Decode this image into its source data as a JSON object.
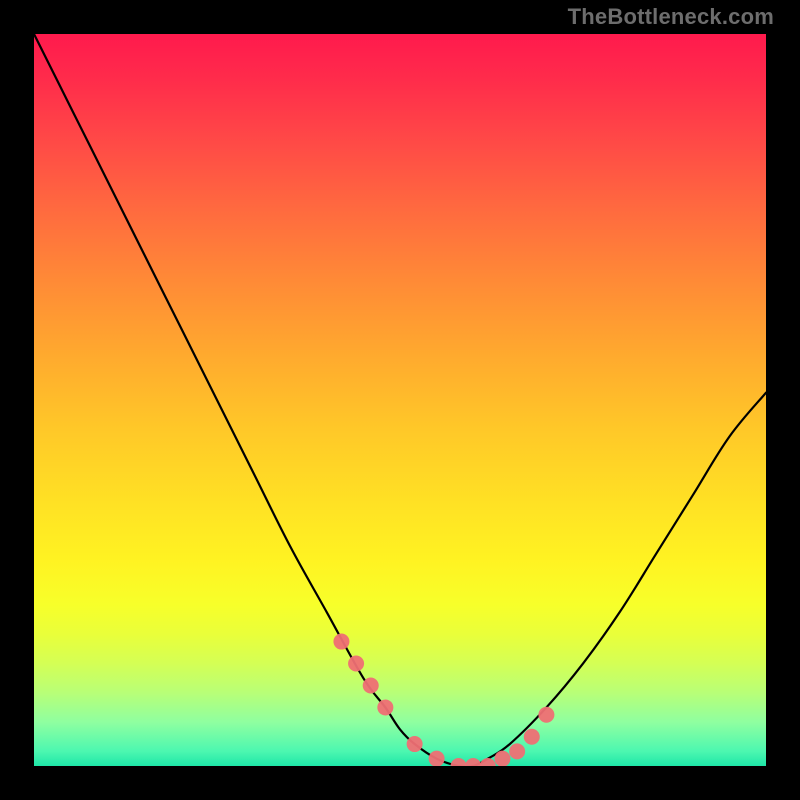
{
  "watermark": "TheBottleneck.com",
  "chart_data": {
    "type": "line",
    "title": "",
    "xlabel": "",
    "ylabel": "",
    "xlim": [
      0,
      100
    ],
    "ylim": [
      0,
      100
    ],
    "grid": false,
    "legend": false,
    "annotations": [],
    "x": [
      0,
      5,
      10,
      15,
      20,
      25,
      30,
      35,
      40,
      45,
      48,
      50,
      52,
      55,
      58,
      60,
      62,
      65,
      70,
      75,
      80,
      85,
      90,
      95,
      100
    ],
    "values": [
      100,
      90,
      80,
      70,
      60,
      50,
      40,
      30,
      21,
      12,
      8,
      5,
      3,
      1,
      0,
      0,
      1,
      3,
      8,
      14,
      21,
      29,
      37,
      45,
      51
    ],
    "marker_points": {
      "x": [
        42,
        44,
        46,
        48,
        52,
        55,
        58,
        60,
        62,
        64,
        66,
        68,
        70
      ],
      "y": [
        17,
        14,
        11,
        8,
        3,
        1,
        0,
        0,
        0,
        1,
        2,
        4,
        7
      ]
    },
    "gradient_stops": [
      {
        "pos": 0,
        "color": "#ff1a4d"
      },
      {
        "pos": 50,
        "color": "#ffe124"
      },
      {
        "pos": 80,
        "color": "#f7ff2a"
      },
      {
        "pos": 100,
        "color": "#1ee6a8"
      }
    ]
  }
}
